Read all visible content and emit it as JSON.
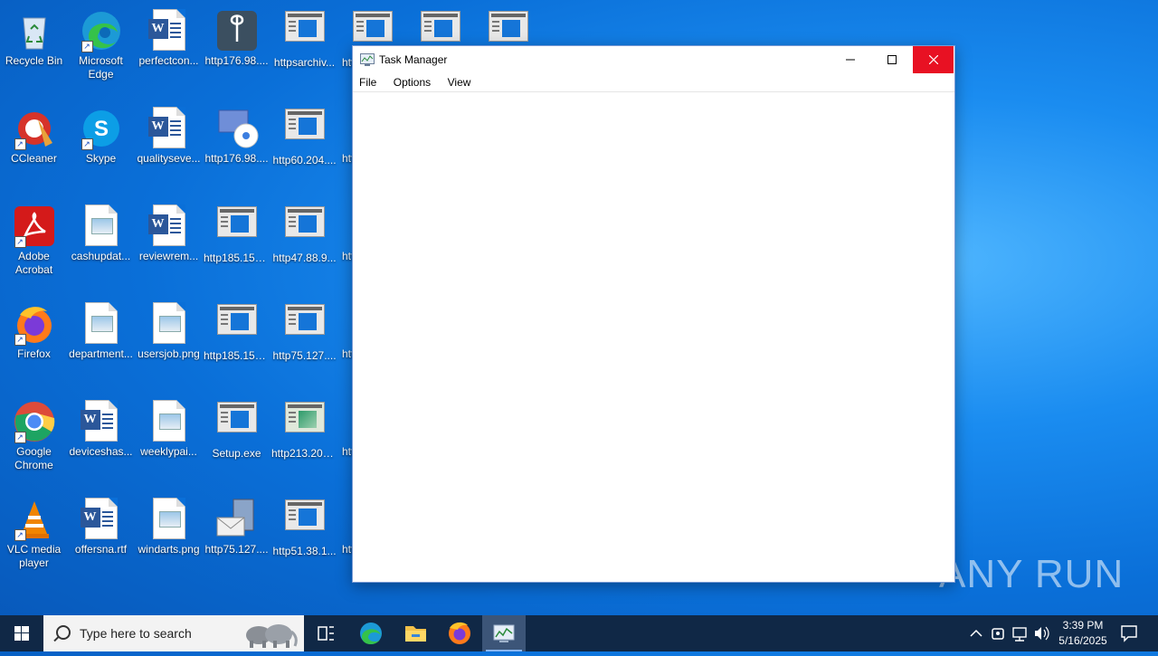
{
  "desktop": {
    "col1": [
      {
        "label": "Recycle Bin",
        "icon": "recycle-bin-icon"
      },
      {
        "label": "CCleaner",
        "icon": "ccleaner-icon"
      },
      {
        "label": "Adobe Acrobat",
        "icon": "acrobat-icon"
      },
      {
        "label": "Firefox",
        "icon": "firefox-icon"
      },
      {
        "label": "Google Chrome",
        "icon": "chrome-icon"
      },
      {
        "label": "VLC media player",
        "icon": "vlc-icon"
      }
    ],
    "col2": [
      {
        "label": "Microsoft Edge",
        "icon": "edge-icon"
      },
      {
        "label": "Skype",
        "icon": "skype-icon"
      },
      {
        "label": "cashupdat...",
        "icon": "image-file-icon"
      },
      {
        "label": "department...",
        "icon": "image-file-icon"
      },
      {
        "label": "deviceshas...",
        "icon": "word-doc-icon"
      },
      {
        "label": "offersna.rtf",
        "icon": "word-doc-icon"
      }
    ],
    "col3": [
      {
        "label": "perfectcon...",
        "icon": "word-doc-icon"
      },
      {
        "label": "qualityseve...",
        "icon": "word-doc-icon"
      },
      {
        "label": "reviewrem...",
        "icon": "word-doc-icon"
      },
      {
        "label": "usersjob.png",
        "icon": "image-file-icon"
      },
      {
        "label": "weeklypai...",
        "icon": "image-file-icon"
      },
      {
        "label": "windarts.png",
        "icon": "image-file-icon"
      }
    ],
    "col4": [
      {
        "label": "http176.98....",
        "icon": "file-tool-icon"
      },
      {
        "label": "http176.98....",
        "icon": "disc-setup-icon"
      },
      {
        "label": "http185.156...",
        "icon": "app-window-icon"
      },
      {
        "label": "http185.156...",
        "icon": "app-window-icon"
      },
      {
        "label": "Setup.exe",
        "icon": "app-window-icon"
      },
      {
        "label": "http75.127....",
        "icon": "mail-server-icon"
      }
    ],
    "col5": [
      {
        "label": "httpsarchiv...",
        "icon": "app-window-icon"
      },
      {
        "label": "http60.204....",
        "icon": "app-window-icon"
      },
      {
        "label": "http47.88.9...",
        "icon": "app-window-icon"
      },
      {
        "label": "http75.127....",
        "icon": "app-window-icon"
      },
      {
        "label": "http213.209...",
        "icon": "app-window-icon"
      },
      {
        "label": "http51.38.1...",
        "icon": "app-window-icon"
      }
    ],
    "col6_partial": [
      "htt",
      "htt",
      "htt",
      "htt",
      "htt",
      "htt"
    ]
  },
  "window": {
    "title": "Task Manager",
    "menu": [
      "File",
      "Options",
      "View"
    ]
  },
  "watermark": "ANY RUN",
  "taskbar": {
    "search_placeholder": "Type here to search",
    "time": "3:39 PM",
    "date": "5/16/2025"
  }
}
